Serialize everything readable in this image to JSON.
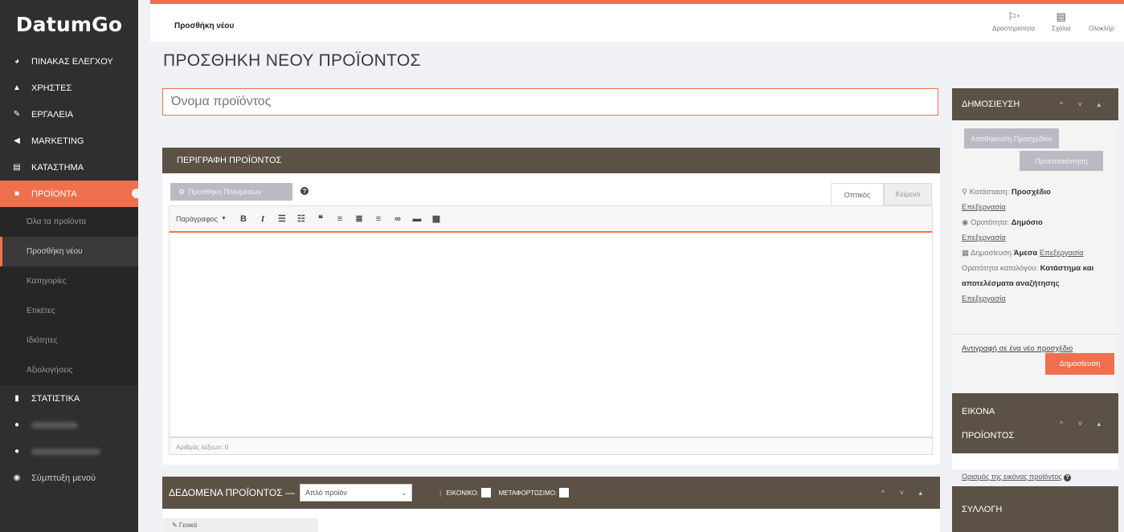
{
  "app": {
    "logo": "DatumGo"
  },
  "sidebar": {
    "items": [
      {
        "label": "ΠΙΝΑΚΑΣ ΕΛΕΓΧΟΥ",
        "icon": "dashboard-icon"
      },
      {
        "label": "ΧΡΗΣΤΕΣ",
        "icon": "users-icon"
      },
      {
        "label": "ΕΡΓΑΛΕΙΑ",
        "icon": "wrench-icon"
      },
      {
        "label": "MARKETING",
        "icon": "megaphone-icon"
      },
      {
        "label": "ΚΑΤΑΣΤΗΜΑ",
        "icon": "store-icon"
      },
      {
        "label": "ΠΡΟΪΟΝΤΑ",
        "icon": "products-icon"
      }
    ],
    "sub_items": [
      {
        "label": "Όλα τα προϊόντα"
      },
      {
        "label": "Προσθήκη νέου"
      },
      {
        "label": "Κατηγορίες"
      },
      {
        "label": "Ετικέτες"
      },
      {
        "label": "Ιδιότητες"
      },
      {
        "label": "Αξιολογήσεις"
      }
    ],
    "stats": {
      "label": "ΣΤΑΤΙΣΤΙΚΑ",
      "icon": "bar-chart-icon"
    },
    "collapse": {
      "label": "Σύμπτυξη μενού",
      "icon": "collapse-circle-icon"
    }
  },
  "topbar": {
    "title": "Προσθήκη νέου",
    "activity": "Δραστηριότητα",
    "notes": "Σχόλια",
    "complete": "Ολοκλήρ"
  },
  "page": {
    "title": "ΠΡΟΣΘΗΚΗ ΝΕΟΥ ΠΡΟΪΟΝΤΟΣ",
    "name_placeholder": "Όνομα προϊόντος"
  },
  "description": {
    "title": "ΠΕΡΙΓΡΑΦΗ ΠΡΟΪΟΝΤΟΣ",
    "add_media": "Προσθήκη Πολυμέσων",
    "tab_visual": "Οπτικός",
    "tab_text": "Κείμενο",
    "format": "Παράγραφος",
    "word_count": "Αριθμός λέξεων: 0"
  },
  "product_data": {
    "title": "ΔΕΔΟΜΕΝΑ ΠΡΟΪΟΝΤΟΣ —",
    "type": "Απλό προϊόν",
    "virtual": "ΕΙΚΟΝΙΚΟ:",
    "downloadable": "ΜΕΤΑΦΟΡΤΩΣΙΜΟ:",
    "general": "Γενικά"
  },
  "publish": {
    "title": "ΔΗΜΟΣΙΕΥΣΗ",
    "save_draft": "Αποθήκευση Προσχεδίου",
    "preview": "Προεπισκόπηση",
    "status_label": "Κατάσταση:",
    "status_value": "Προσχέδιο",
    "edit": "Επεξεργασία",
    "visibility_label": "Ορατότητα:",
    "visibility_value": "Δημόσιο",
    "publish_label": "Δημοσίευση",
    "publish_value": "Άμεσα",
    "catalog_label": "Ορατότητα καταλόγου:",
    "catalog_value": "Κατάστημα και αποτελέσματα αναζήτησης",
    "copy_draft": "Αντιγραφή σε ένα νέο προσχέδιο",
    "publish_button": "Δημοσίευση"
  },
  "image": {
    "title_1": "ΕΙΚΟΝΑ",
    "title_2": "ΠΡΟΪΟΝΤΟΣ",
    "set_image": "Ορισμός της εικόνας προϊόντος"
  },
  "collection": {
    "title": "ΣΥΛΛΟΓΗ"
  },
  "colors": {
    "accent": "#f0704e",
    "panel_header": "#5c5145",
    "sidebar": "#2f2f2f"
  }
}
